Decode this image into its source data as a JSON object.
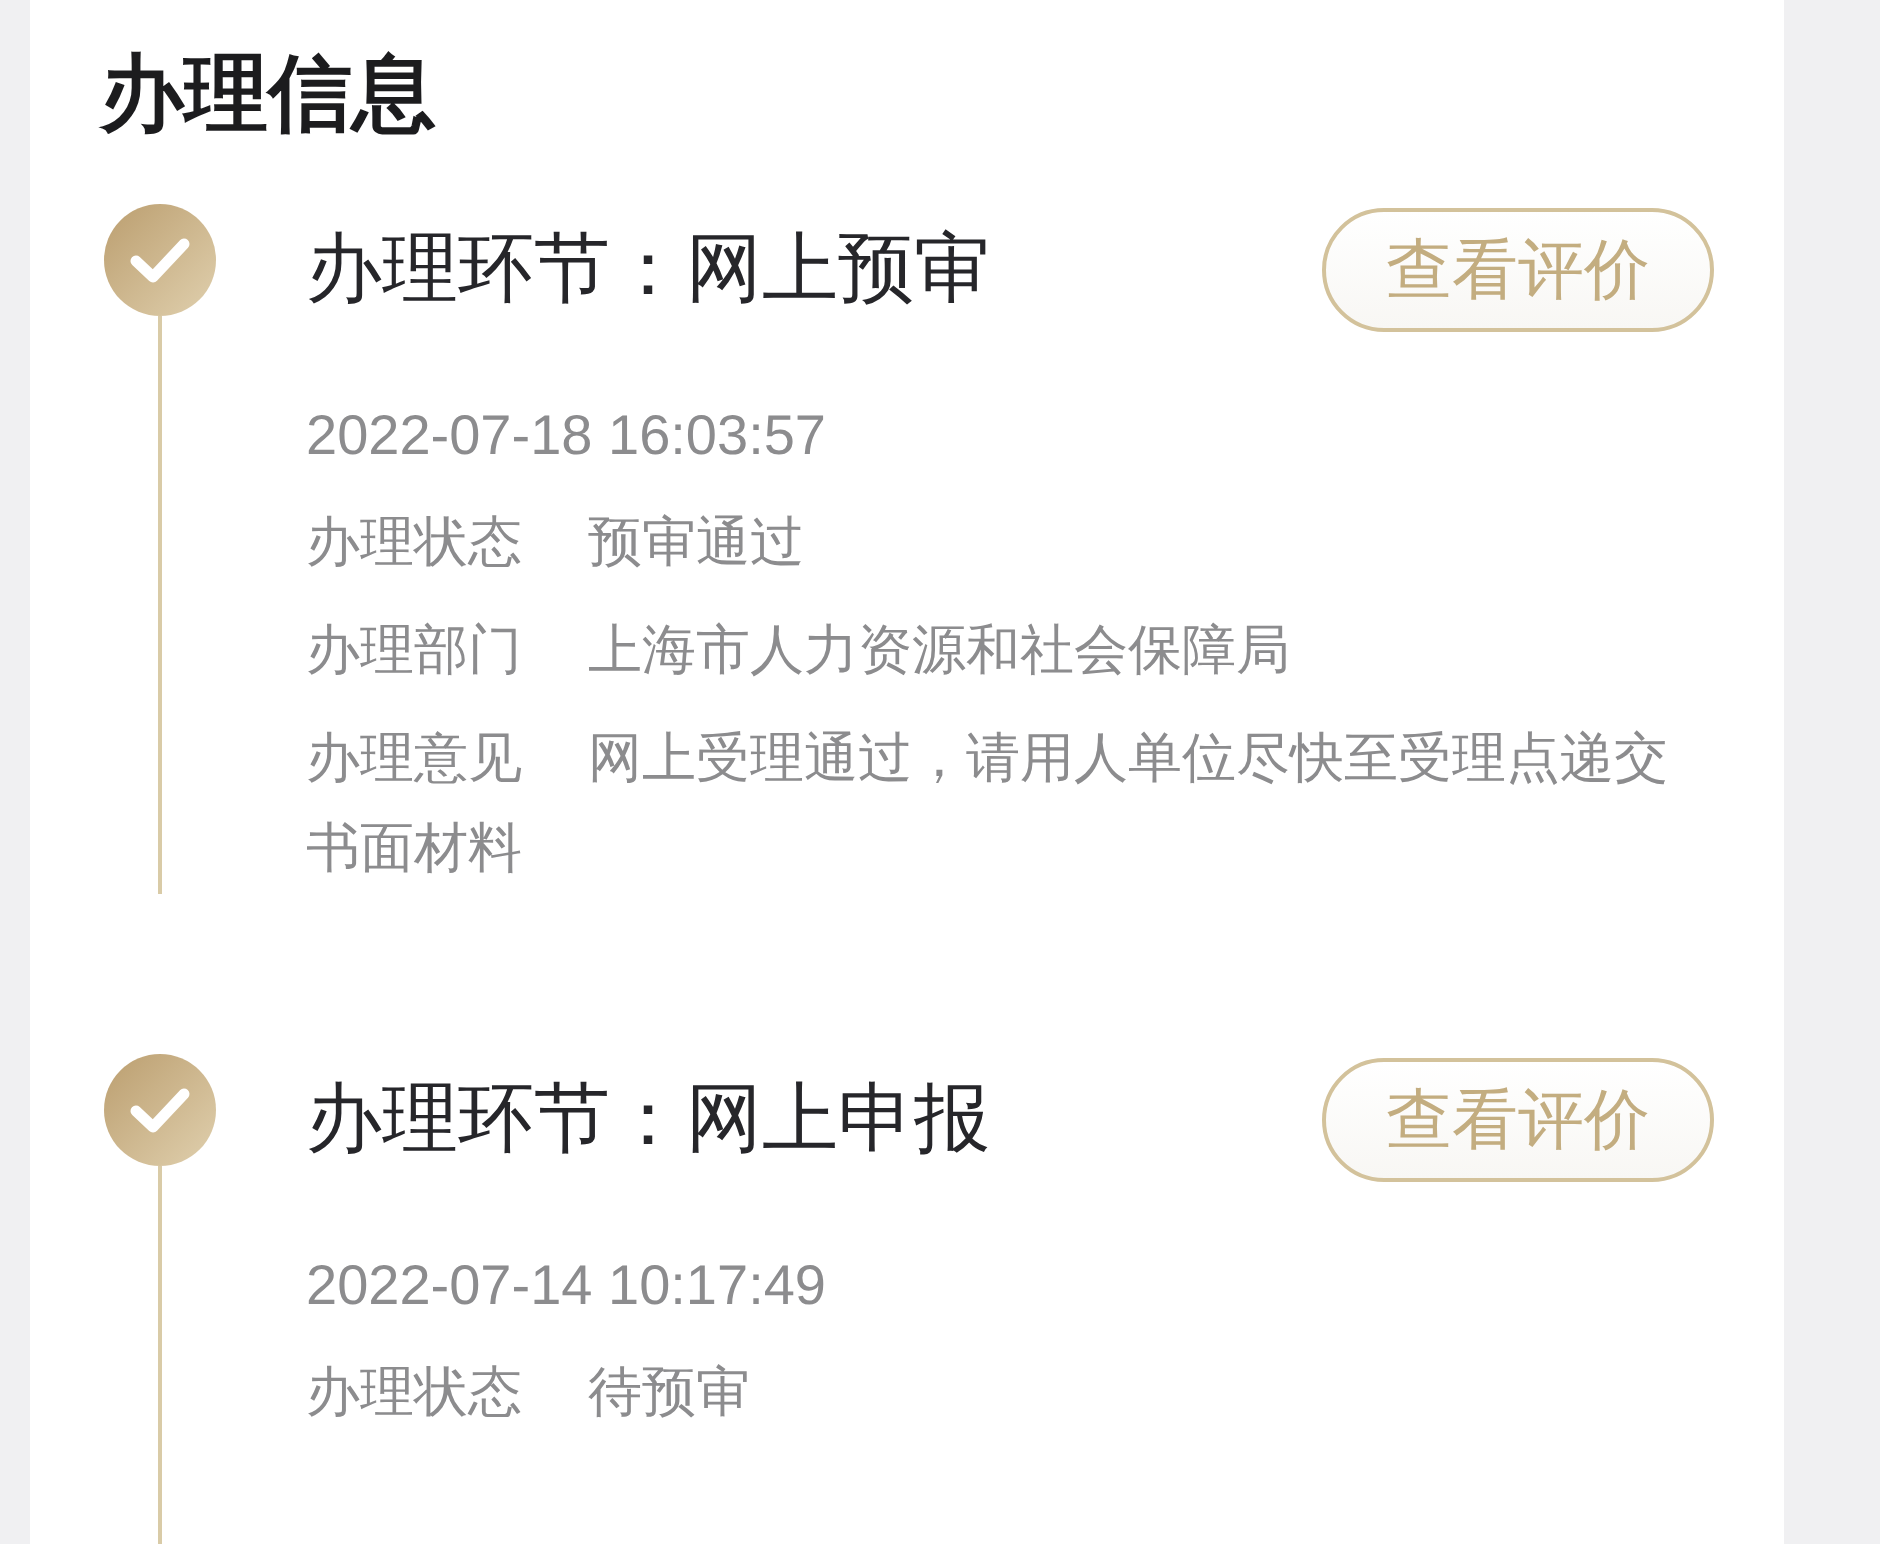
{
  "section": {
    "title": "办理信息"
  },
  "steps": [
    {
      "title": "办理环节：网上预审",
      "completed": true,
      "button": "查看评价",
      "time": "2022-07-18 16:03:57",
      "fields": [
        {
          "label": "办理状态",
          "value": "预审通过"
        },
        {
          "label": "办理部门",
          "value": "上海市人力资源和社会保障局"
        },
        {
          "label": "办理意见",
          "value": "网上受理通过，请用人单位尽快至受理点递交书面材料"
        }
      ]
    },
    {
      "title": "办理环节：网上申报",
      "completed": true,
      "button": "查看评价",
      "time": "2022-07-14 10:17:49",
      "fields": [
        {
          "label": "办理状态",
          "value": "待预审"
        }
      ]
    }
  ]
}
